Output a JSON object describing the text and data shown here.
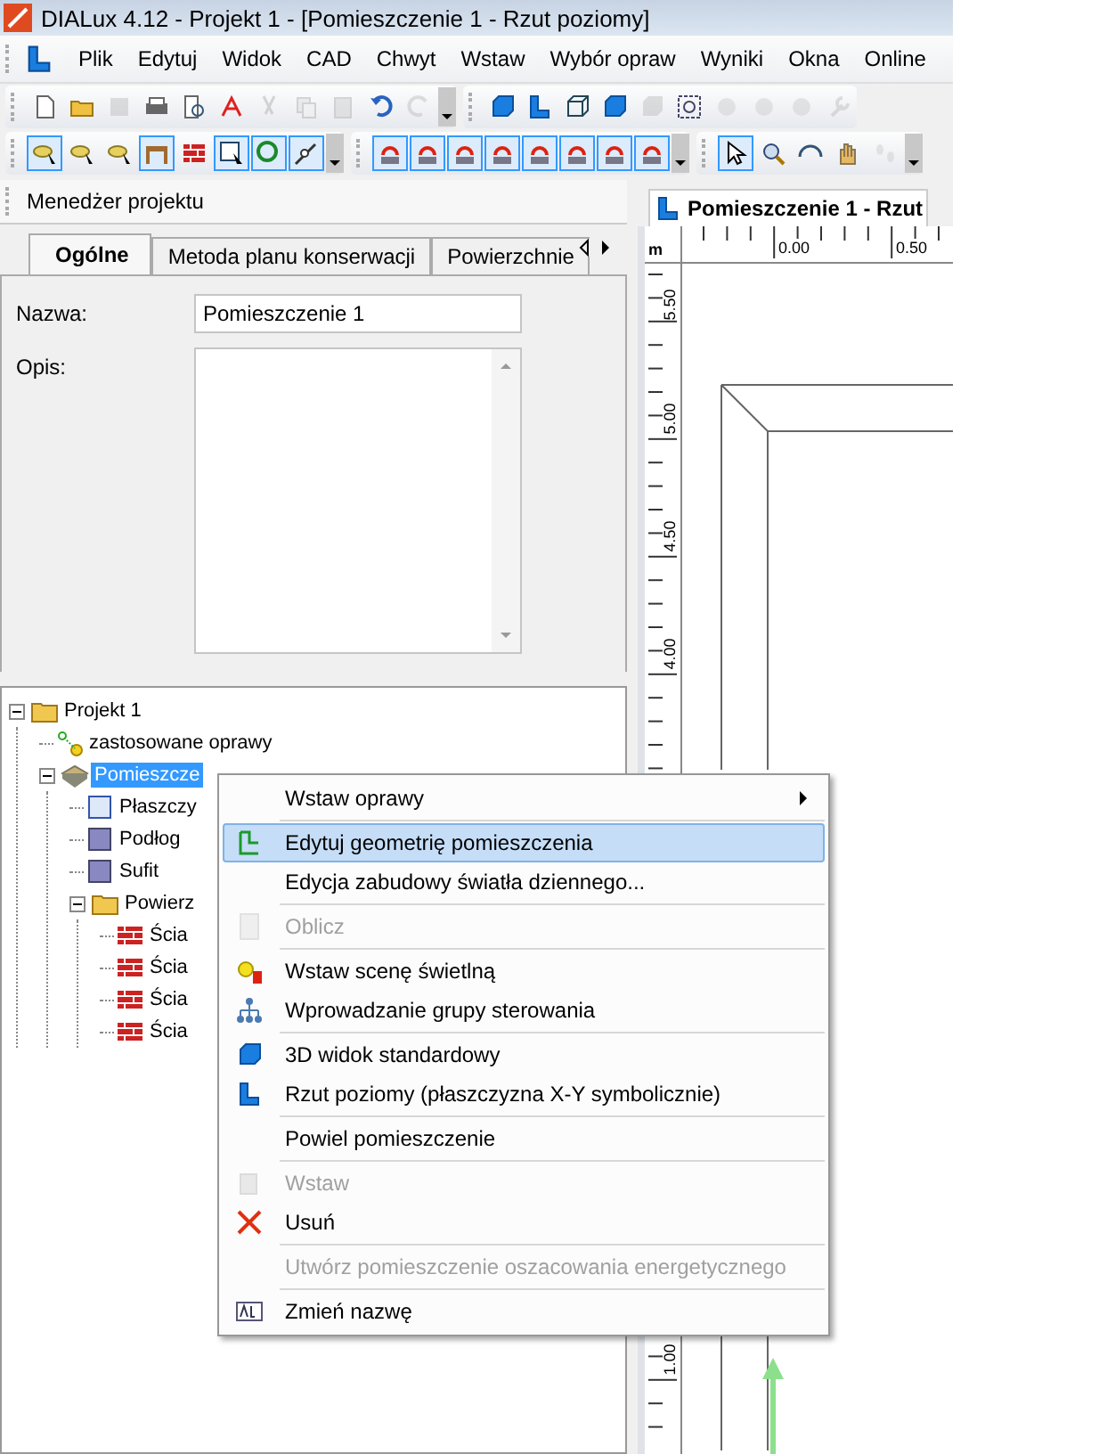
{
  "window": {
    "title": "DIALux 4.12 - Projekt 1 - [Pomieszczenie 1 - Rzut poziomy]"
  },
  "menu_bar": [
    "Plik",
    "Edytuj",
    "Widok",
    "CAD",
    "Chwyt",
    "Wstaw",
    "Wybór opraw",
    "Wyniki",
    "Okna",
    "Online"
  ],
  "toolbars": [
    [
      [
        {
          "pressed": false,
          "disabled": false
        },
        {
          "pressed": false,
          "disabled": false
        },
        {
          "pressed": false,
          "disabled": true
        },
        {
          "pressed": false,
          "disabled": false
        },
        {
          "pressed": false,
          "disabled": false
        },
        {
          "pressed": false,
          "disabled": false
        },
        {
          "pressed": false,
          "disabled": true
        },
        {
          "pressed": false,
          "disabled": true
        },
        {
          "pressed": false,
          "disabled": true
        },
        {
          "pressed": false,
          "disabled": false
        },
        {
          "pressed": false,
          "disabled": true
        }
      ],
      [
        {
          "pressed": false,
          "disabled": false
        },
        {
          "pressed": false,
          "disabled": false
        },
        {
          "pressed": false,
          "disabled": false
        },
        {
          "pressed": false,
          "disabled": false
        },
        {
          "pressed": false,
          "disabled": true
        },
        {
          "pressed": false,
          "disabled": false
        },
        {
          "pressed": false,
          "disabled": true
        },
        {
          "pressed": false,
          "disabled": true
        },
        {
          "pressed": false,
          "disabled": true
        },
        {
          "pressed": false,
          "disabled": true
        }
      ]
    ],
    [
      [
        {
          "pressed": true,
          "disabled": false
        },
        {
          "pressed": false,
          "disabled": false
        },
        {
          "pressed": false,
          "disabled": false
        },
        {
          "pressed": true,
          "disabled": false
        },
        {
          "pressed": false,
          "disabled": false
        },
        {
          "pressed": true,
          "disabled": false
        },
        {
          "pressed": true,
          "disabled": false
        },
        {
          "pressed": true,
          "disabled": false
        }
      ],
      [
        {
          "pressed": true,
          "disabled": false
        },
        {
          "pressed": true,
          "disabled": false
        },
        {
          "pressed": true,
          "disabled": false
        },
        {
          "pressed": true,
          "disabled": false
        },
        {
          "pressed": true,
          "disabled": false
        },
        {
          "pressed": true,
          "disabled": false
        },
        {
          "pressed": true,
          "disabled": false
        },
        {
          "pressed": true,
          "disabled": false
        }
      ],
      [
        {
          "pressed": true,
          "disabled": false
        },
        {
          "pressed": false,
          "disabled": false
        },
        {
          "pressed": false,
          "disabled": false
        },
        {
          "pressed": false,
          "disabled": false
        },
        {
          "pressed": false,
          "disabled": true
        }
      ]
    ]
  ],
  "project_manager": {
    "title": "Menedżer projektu",
    "tabs": [
      {
        "label": "Ogólne",
        "selected": true
      },
      {
        "label": "Metoda planu konserwacji",
        "selected": false
      },
      {
        "label": "Powierzchnie",
        "selected": false
      }
    ],
    "fields": [
      {
        "kind": "text",
        "label": "Nazwa:",
        "value": "Pomieszczenie 1"
      },
      {
        "kind": "textarea",
        "label": "Opis:"
      }
    ]
  },
  "tree": [
    {
      "kind": "folder",
      "label": "Projekt 1",
      "expanded": true,
      "selected": false,
      "children": [
        {
          "kind": "luminaires",
          "label": "zastosowane oprawy",
          "selected": false
        },
        {
          "kind": "room",
          "label": "Pomieszcze",
          "expanded": true,
          "selected": true,
          "children": [
            {
              "kind": "plane",
              "label": "Płaszczy",
              "selected": false
            },
            {
              "kind": "floor",
              "label": "Podłog",
              "selected": false
            },
            {
              "kind": "ceiling",
              "label": "Sufit",
              "selected": false
            },
            {
              "kind": "folder",
              "label": "Powierz",
              "expanded": true,
              "selected": false,
              "children": [
                {
                  "kind": "wall",
                  "label": "Ścia",
                  "selected": false
                },
                {
                  "kind": "wall",
                  "label": "Ścia",
                  "selected": false
                },
                {
                  "kind": "wall",
                  "label": "Ścia",
                  "selected": false
                },
                {
                  "kind": "wall",
                  "label": "Ścia",
                  "selected": false
                }
              ]
            }
          ]
        }
      ]
    }
  ],
  "document_tab": {
    "title": "Pomieszczenie 1 - Rzut"
  },
  "ruler": {
    "unit": "m",
    "top_labels": [
      "0.00",
      "0.50"
    ],
    "left_labels": [
      "5.50",
      "5.00",
      "4.50",
      "4.00",
      "1.00"
    ]
  },
  "context_menu": [
    {
      "kind": "item",
      "label": "Wstaw oprawy",
      "disabled": false,
      "selected": false,
      "submenu": true
    },
    {
      "kind": "separator"
    },
    {
      "kind": "item",
      "label": "Edytuj geometrię pomieszczenia",
      "disabled": false,
      "selected": true,
      "submenu": false
    },
    {
      "kind": "item",
      "label": "Edycja zabudowy światła dziennego...",
      "disabled": false,
      "selected": false,
      "submenu": false
    },
    {
      "kind": "separator"
    },
    {
      "kind": "item",
      "label": "Oblicz",
      "disabled": true,
      "selected": false,
      "submenu": false
    },
    {
      "kind": "separator"
    },
    {
      "kind": "item",
      "label": "Wstaw scenę świetlną",
      "disabled": false,
      "selected": false,
      "submenu": false
    },
    {
      "kind": "item",
      "label": "Wprowadzanie grupy sterowania",
      "disabled": false,
      "selected": false,
      "submenu": false
    },
    {
      "kind": "separator"
    },
    {
      "kind": "item",
      "label": "3D widok standardowy",
      "disabled": false,
      "selected": false,
      "submenu": false
    },
    {
      "kind": "item",
      "label": "Rzut poziomy (płaszczyzna X-Y symbolicznie)",
      "disabled": false,
      "selected": false,
      "submenu": false
    },
    {
      "kind": "separator"
    },
    {
      "kind": "item",
      "label": "Powiel pomieszczenie",
      "disabled": false,
      "selected": false,
      "submenu": false
    },
    {
      "kind": "separator"
    },
    {
      "kind": "item",
      "label": "Wstaw",
      "disabled": true,
      "selected": false,
      "submenu": false
    },
    {
      "kind": "item",
      "label": "Usuń",
      "disabled": false,
      "selected": false,
      "submenu": false
    },
    {
      "kind": "separator"
    },
    {
      "kind": "item",
      "label": "Utwórz pomieszczenie oszacowania energetycznego",
      "disabled": true,
      "selected": false,
      "submenu": false
    },
    {
      "kind": "separator"
    },
    {
      "kind": "item",
      "label": "Zmień nazwę",
      "disabled": false,
      "selected": false,
      "submenu": false
    }
  ]
}
